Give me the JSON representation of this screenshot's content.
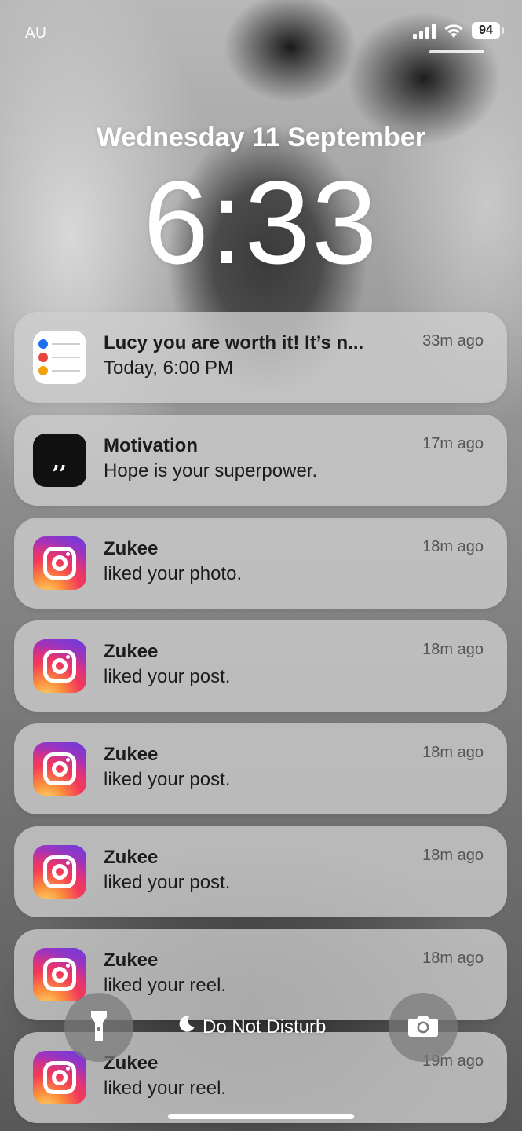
{
  "status_bar": {
    "carrier": "AU",
    "battery_level": "94",
    "signal_icon": "cellular-signal-icon",
    "wifi_icon": "wifi-icon",
    "battery_icon": "battery-icon"
  },
  "lock_screen": {
    "date": "Wednesday 11 September",
    "time": "6:33"
  },
  "notifications": [
    {
      "app_icon": "reminders-app-icon",
      "title": "Lucy you are worth it! It’s n...",
      "body": "Today, 6:00 PM",
      "time": "33m ago"
    },
    {
      "app_icon": "quote-app-icon",
      "title": "Motivation",
      "body": "Hope is your superpower.",
      "time": "17m ago"
    },
    {
      "app_icon": "instagram-app-icon",
      "title": "Zukee",
      "body": "liked your photo.",
      "time": "18m ago"
    },
    {
      "app_icon": "instagram-app-icon",
      "title": "Zukee",
      "body": "liked your post.",
      "time": "18m ago"
    },
    {
      "app_icon": "instagram-app-icon",
      "title": "Zukee",
      "body": "liked your post.",
      "time": "18m ago"
    },
    {
      "app_icon": "instagram-app-icon",
      "title": "Zukee",
      "body": "liked your post.",
      "time": "18m ago"
    },
    {
      "app_icon": "instagram-app-icon",
      "title": "Zukee",
      "body": "liked your reel.",
      "time": "18m ago"
    },
    {
      "app_icon": "instagram-app-icon",
      "title": "Zukee",
      "body": "liked your reel.",
      "time": "19m ago"
    }
  ],
  "bottom_bar": {
    "focus_label": "Do Not Disturb",
    "focus_icon": "moon-icon",
    "flashlight_icon": "flashlight-icon",
    "camera_icon": "camera-icon"
  },
  "colors": {
    "reminder_dot_blue": "#1e6ef0",
    "reminder_dot_red": "#e8453c",
    "reminder_dot_orange": "#f2a20c"
  }
}
